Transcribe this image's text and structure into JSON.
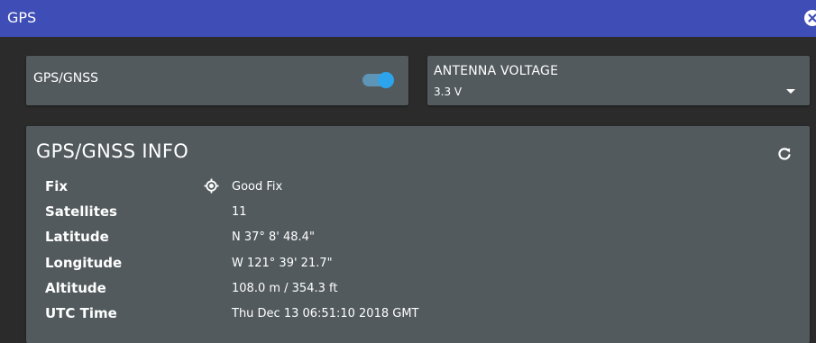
{
  "window": {
    "title": "GPS",
    "close_icon": "close-circle-icon",
    "titlebar_color": "#3e4eb6"
  },
  "gps_card": {
    "label": "GPS/GNSS",
    "toggle_on": true,
    "toggle_color": "#2ca3ea"
  },
  "antenna_card": {
    "title": "ANTENNA VOLTAGE",
    "value": "3.3 V",
    "dropdown_icon": "caret-down-icon"
  },
  "info_card": {
    "title": "GPS/GNSS INFO",
    "refresh_icon": "refresh-icon",
    "fix_icon": "crosshair-icon",
    "rows": [
      {
        "label": "Fix",
        "value": "Good Fix"
      },
      {
        "label": "Satellites",
        "value": "11"
      },
      {
        "label": "Latitude",
        "value": "N 37° 8' 48.4\""
      },
      {
        "label": "Longitude",
        "value": "W 121° 39' 21.7\""
      },
      {
        "label": "Altitude",
        "value": "108.0 m / 354.3 ft"
      },
      {
        "label": "UTC Time",
        "value": "Thu Dec 13 06:51:10 2018 GMT"
      }
    ]
  }
}
